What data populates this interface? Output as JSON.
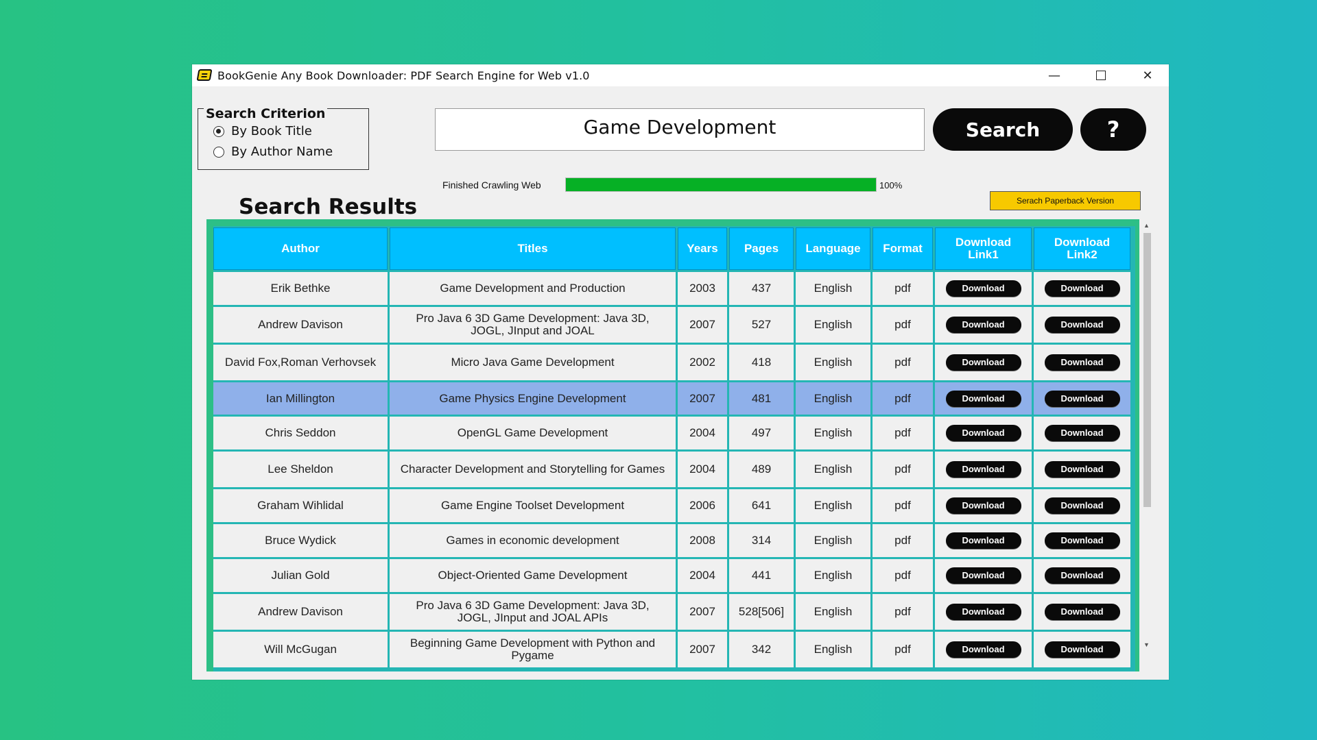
{
  "window": {
    "title": "BookGenie Any Book Downloader: PDF Search Engine for Web v1.0",
    "controls": {
      "minimize": "—",
      "close": "✕"
    }
  },
  "criterion": {
    "legend": "Search Criterion",
    "options": [
      {
        "label": "By Book Title",
        "selected": true
      },
      {
        "label": "By Author Name",
        "selected": false
      }
    ]
  },
  "search": {
    "query": "Game Development",
    "button_label": "Search",
    "help_label": "?"
  },
  "progress": {
    "status": "Finished Crawling Web",
    "percent_label": "100%",
    "value": 1.0
  },
  "paperback_label": "Serach Paperback Version",
  "results_title": "Search Results",
  "table": {
    "headers": {
      "author": "Author",
      "titles": "Titles",
      "years": "Years",
      "pages": "Pages",
      "language": "Language",
      "format": "Format",
      "link1_line1": "Download",
      "link1_line2": "Link1",
      "link2_line1": "Download",
      "link2_line2": "Link2"
    },
    "download_label": "Download",
    "selected_row": 3,
    "rows": [
      {
        "author": "Erik Bethke",
        "title": "Game Development and Production",
        "year": "2003",
        "pages": "437",
        "language": "English",
        "format": "pdf"
      },
      {
        "author": "Andrew Davison",
        "title": "Pro Java 6 3D Game Development: Java 3D, JOGL, JInput and JOAL",
        "year": "2007",
        "pages": "527",
        "language": "English",
        "format": "pdf"
      },
      {
        "author": "David Fox,Roman Verhovsek",
        "title": "Micro Java Game Development",
        "year": "2002",
        "pages": "418",
        "language": "English",
        "format": "pdf"
      },
      {
        "author": "Ian Millington",
        "title": "Game Physics Engine Development",
        "year": "2007",
        "pages": "481",
        "language": "English",
        "format": "pdf"
      },
      {
        "author": "Chris Seddon",
        "title": "OpenGL Game Development",
        "year": "2004",
        "pages": "497",
        "language": "English",
        "format": "pdf"
      },
      {
        "author": "Lee Sheldon",
        "title": "Character Development and Storytelling for Games",
        "year": "2004",
        "pages": "489",
        "language": "English",
        "format": "pdf"
      },
      {
        "author": "Graham Wihlidal",
        "title": "Game Engine Toolset Development",
        "year": "2006",
        "pages": "641",
        "language": "English",
        "format": "pdf"
      },
      {
        "author": "Bruce Wydick",
        "title": "Games in economic development",
        "year": "2008",
        "pages": "314",
        "language": "English",
        "format": "pdf"
      },
      {
        "author": "Julian Gold",
        "title": "Object-Oriented Game Development",
        "year": "2004",
        "pages": "441",
        "language": "English",
        "format": "pdf"
      },
      {
        "author": "Andrew Davison",
        "title": "Pro Java 6 3D Game Development: Java 3D, JOGL, JInput and JOAL APIs",
        "year": "2007",
        "pages": "528[506]",
        "language": "English",
        "format": "pdf"
      },
      {
        "author": "Will McGugan",
        "title": "Beginning Game Development with Python and Pygame",
        "year": "2007",
        "pages": "342",
        "language": "English",
        "format": "pdf"
      }
    ]
  }
}
